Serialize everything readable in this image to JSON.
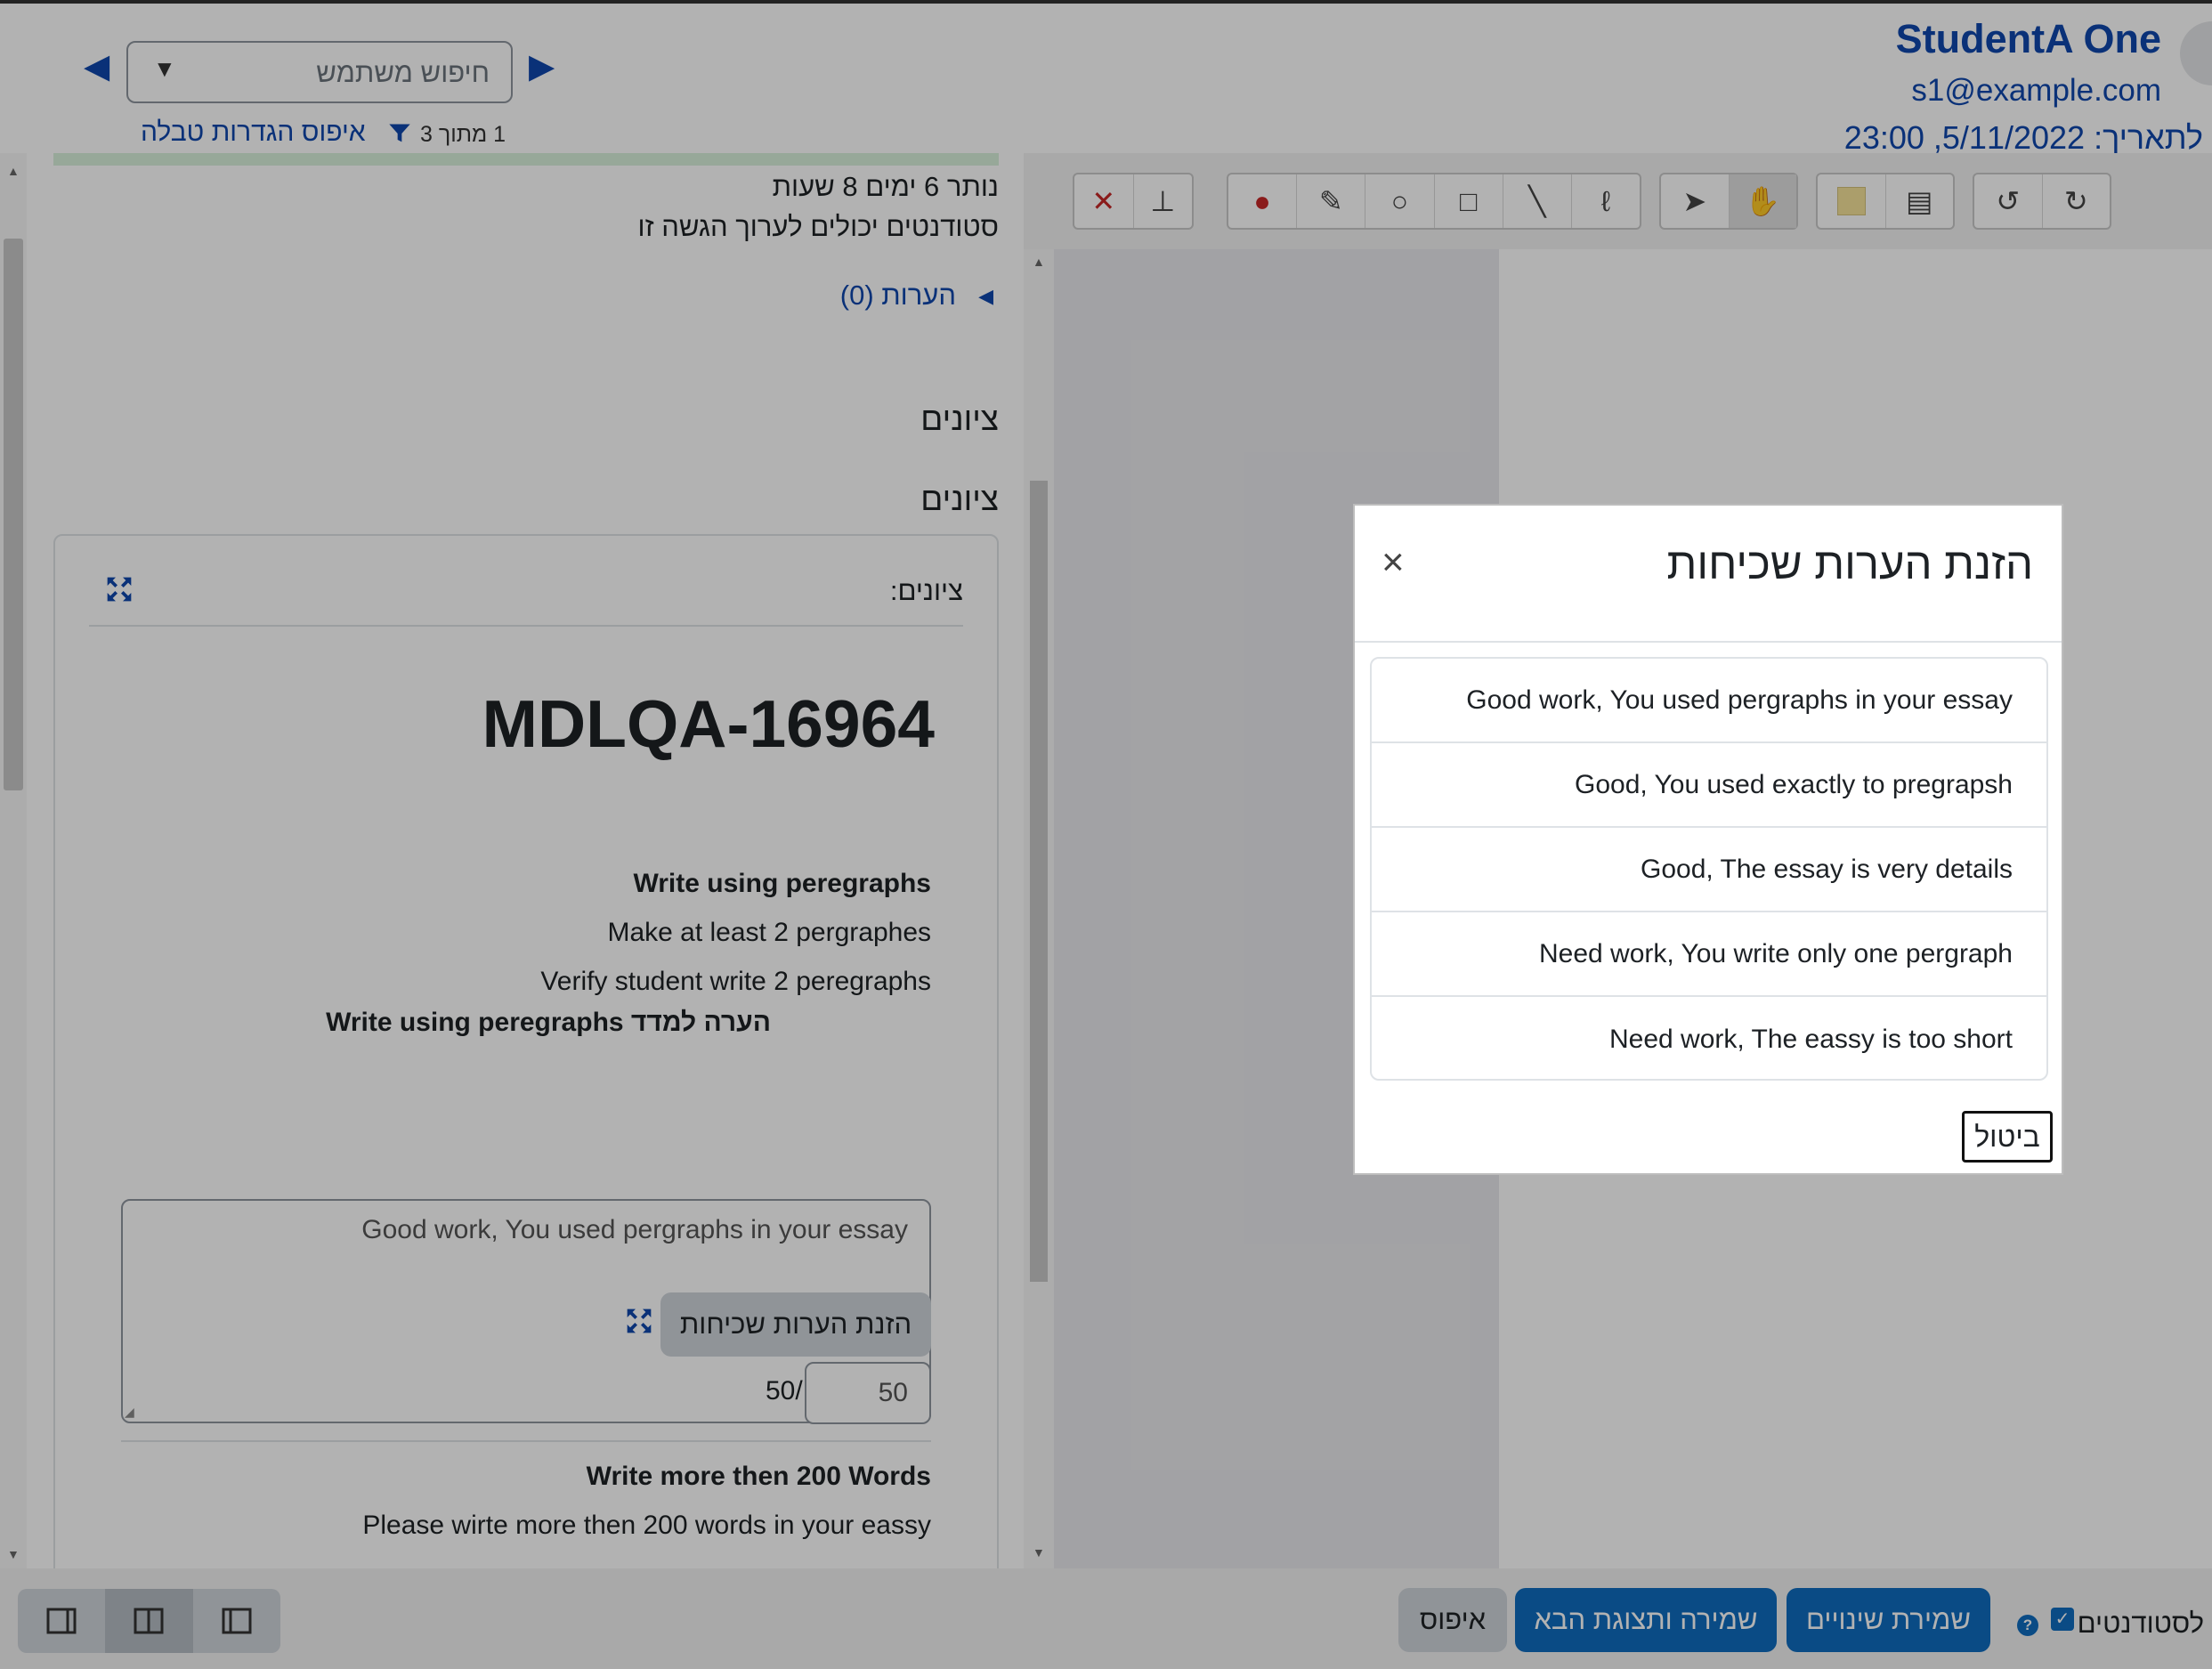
{
  "header": {
    "student_name": "StudentA One",
    "student_email": "s1@example.com",
    "due_date": "לתאריך: 5/11/2022, 23:00",
    "user_search_placeholder": "חיפוש משתמש",
    "reset_table_label": "איפוס הגדרות טבלה",
    "filter_count": "1 מתוך 3"
  },
  "panel": {
    "remaining_time": "נותר 6 ימים 8 שעות",
    "students_can_edit": "סטודנטים יכולים לערוך הגשה זו",
    "comments_link": "הערות (0)",
    "grades_heading_1": "ציונים",
    "grades_heading_2": "ציונים",
    "card_label": "ציונים:",
    "guide_title": "MDLQA-16964",
    "criteria": [
      {
        "title": "Write using peregraphs",
        "description": "Make at least 2 pergraphes",
        "marker_desc": "Verify student write 2 peregraphs",
        "remark_label": "הערה למדד Write using peregraphs",
        "remark_value": "Good work, You used pergraphs in your essay",
        "frequent_button": "הזנת הערות שכיחות",
        "score": "50",
        "max_score": "50/"
      },
      {
        "title": "Write more then 200 Words",
        "description": "Please wirte more then 200 words in your eassy"
      }
    ]
  },
  "footer": {
    "notify_students_label": "לסטודנטים",
    "save_button": "שמירת שינויים",
    "save_next_button": "שמירה ותצוגת הבא",
    "reset_button": "איפוס"
  },
  "modal": {
    "title": "הזנת הערות שכיחות",
    "close_symbol": "×",
    "items": [
      "Good work, You used pergraphs in your essay",
      "Good, You used exactly to pregrapsh",
      "Good, The essay is very details",
      "Need work, You write only one pergraph",
      "Need work, The eassy is too short"
    ],
    "cancel_button": "ביטול"
  },
  "colors": {
    "link_blue": "#0f47ad",
    "button_blue": "#0f6cbf",
    "overlay": "rgba(0,0,0,0.30)"
  }
}
